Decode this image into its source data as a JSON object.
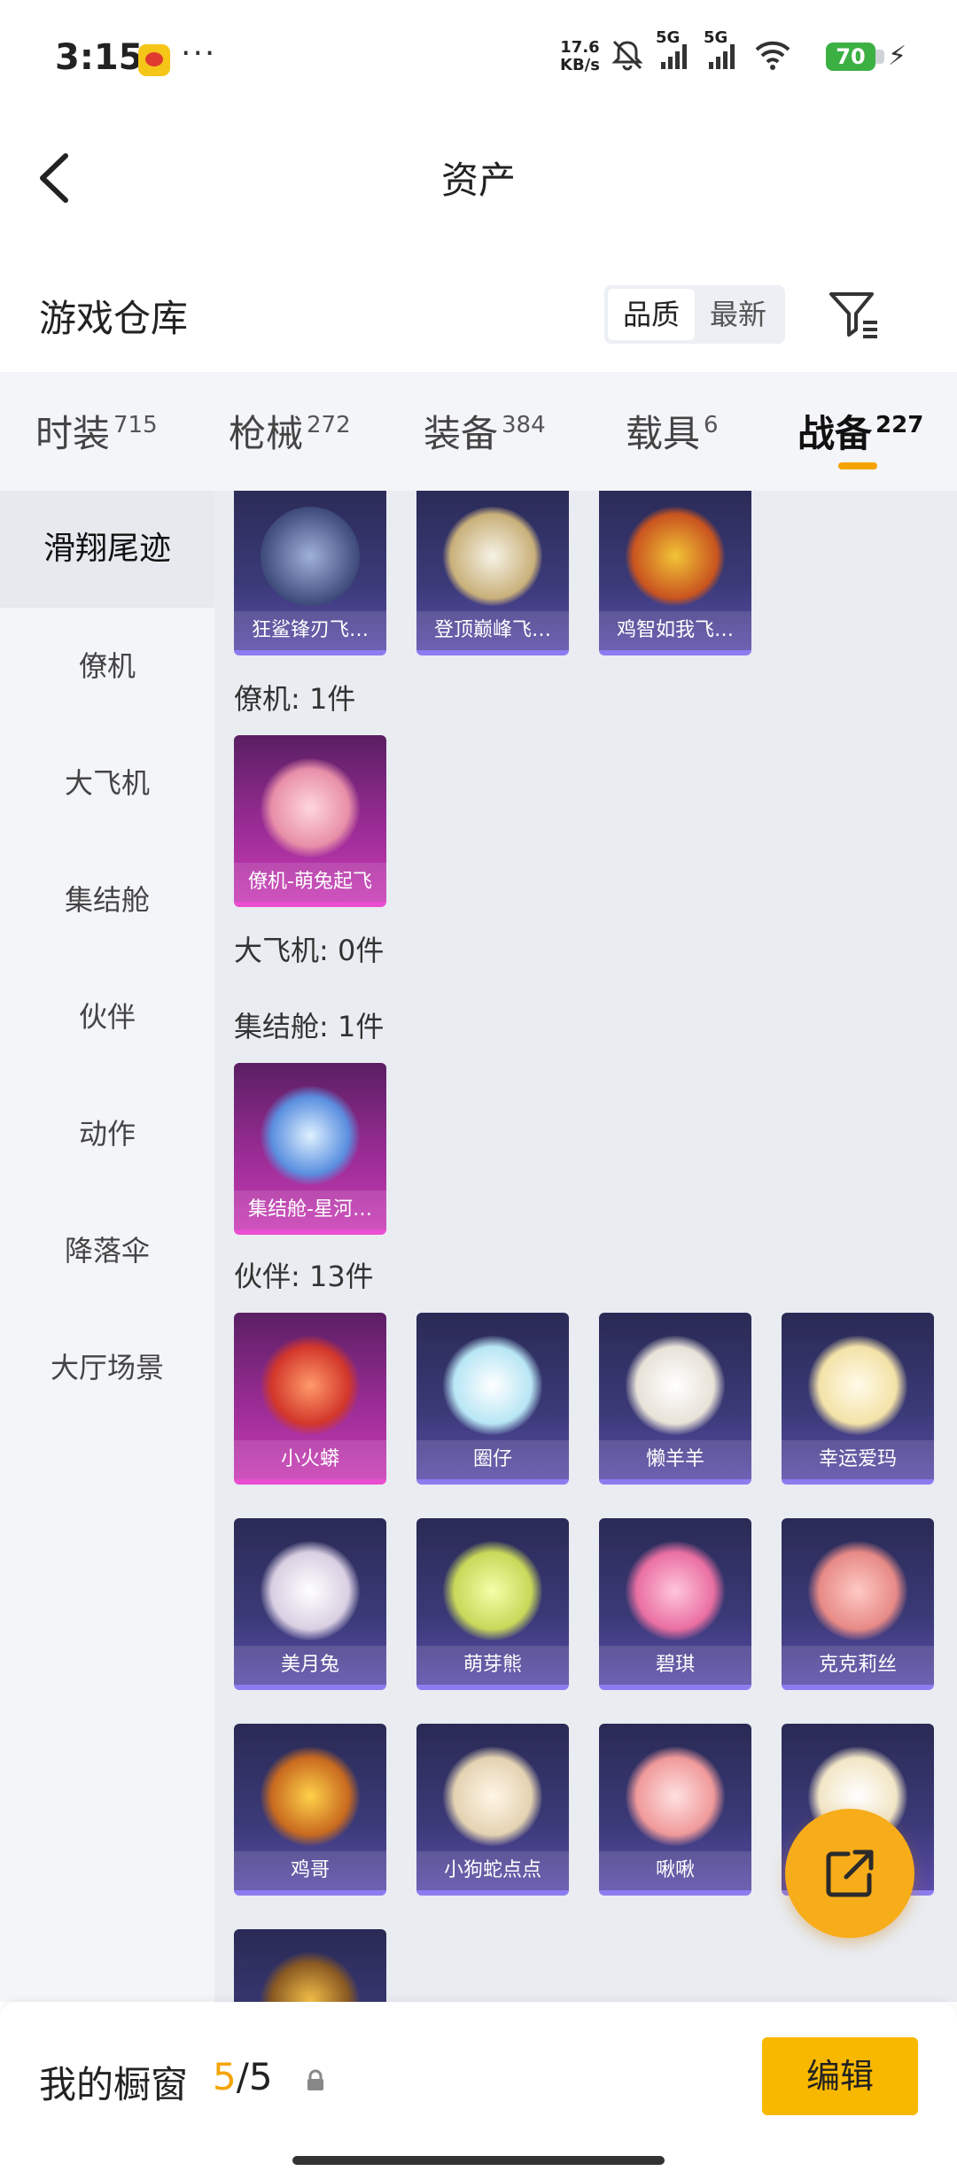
{
  "status_bar": {
    "time": "3:15",
    "dots": "···",
    "net_speed_value": "17.6",
    "net_speed_unit": "KB/s",
    "signal_label_1": "5G",
    "signal_label_2": "5G",
    "battery": "70",
    "icons": [
      "app-badge-icon",
      "mute-icon",
      "signal-icon",
      "wifi-icon",
      "battery-icon",
      "charging-icon"
    ]
  },
  "header": {
    "title": "资产"
  },
  "warehouse": {
    "title": "游戏仓库",
    "sort_options": [
      "品质",
      "最新"
    ],
    "sort_selected": "品质"
  },
  "category_tabs": [
    {
      "label": "时装",
      "count": "715"
    },
    {
      "label": "枪械",
      "count": "272"
    },
    {
      "label": "装备",
      "count": "384"
    },
    {
      "label": "载具",
      "count": "6"
    },
    {
      "label": "战备",
      "count": "227",
      "active": true
    }
  ],
  "side_nav": {
    "items": [
      "滑翔尾迹",
      "僚机",
      "大飞机",
      "集结舱",
      "伙伴",
      "动作",
      "降落伞",
      "大厅场景"
    ],
    "active": "滑翔尾迹"
  },
  "content": {
    "trail_items": [
      "狂鲨锋刃飞…",
      "登顶巅峰飞…",
      "鸡智如我飞…"
    ],
    "sections": [
      {
        "title": "僚机: 1件",
        "items": [
          "僚机-萌兔起飞"
        ]
      },
      {
        "title": "大飞机: 0件",
        "items": []
      },
      {
        "title": "集结舱: 1件",
        "items": [
          "集结舱-星河…"
        ]
      },
      {
        "title": "伙伴: 13件",
        "items": [
          "小火蟒",
          "圈仔",
          "懒羊羊",
          "幸运爱玛",
          "美月兔",
          "萌芽熊",
          "碧琪",
          "克克莉丝",
          "鸡哥",
          "小狗蛇点点",
          "啾啾"
        ]
      }
    ]
  },
  "bottom_bar": {
    "label": "我的橱窗",
    "count_current": "5",
    "count_total": "/5",
    "edit_label": "编辑"
  },
  "colors": {
    "accent": "#f5a300",
    "button": "#f9b800",
    "card_epic": "#3b3a78",
    "card_legend": "#9a2c95"
  }
}
